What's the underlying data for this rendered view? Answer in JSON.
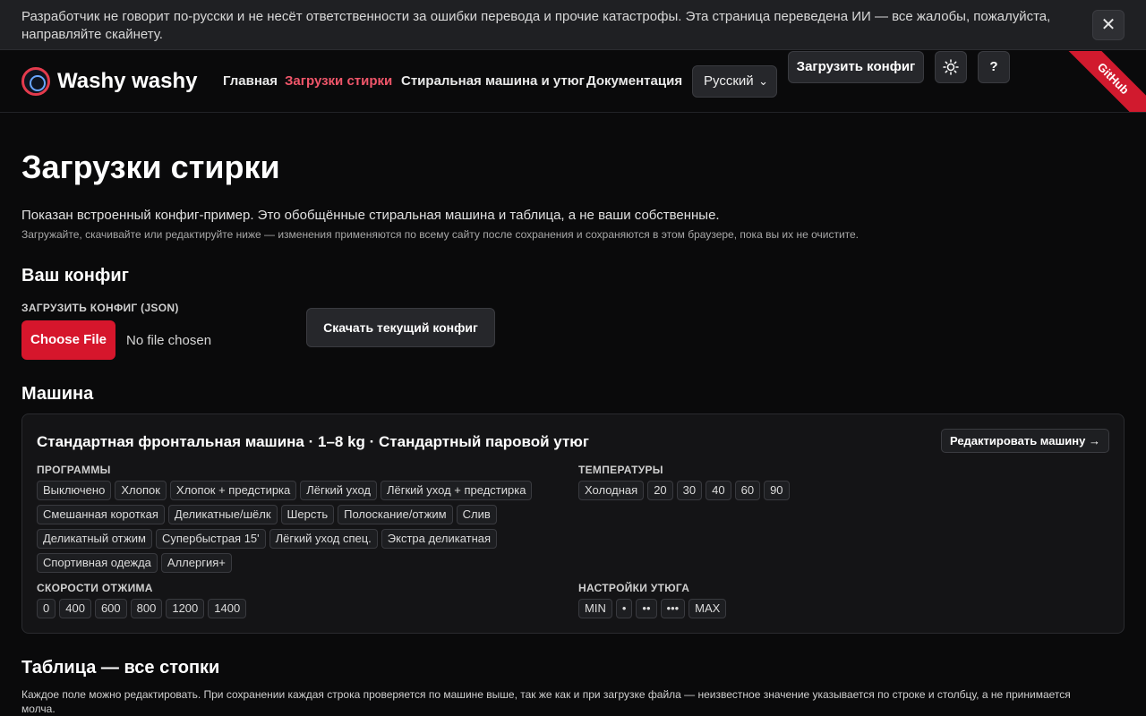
{
  "banner": {
    "text": "Разработчик не говорит по-русски и не несёт ответственности за ошибки перевода и прочие катастрофы. Эта страница переведена ИИ — все жалобы, пожалуйста, направляйте скайнету.",
    "close": "✕"
  },
  "nav": {
    "brand": "Washy washy",
    "links": [
      "Главная",
      "Загрузки стирки",
      "Стиральная машина и утюг",
      "Документация"
    ],
    "language": "Русский",
    "upload_config": "Загрузить конфиг",
    "theme_icon": "sun-icon",
    "help": "?",
    "ribbon": "GitHub"
  },
  "page": {
    "title": "Загрузки стирки",
    "lead": "Показан встроенный конфиг-пример. Это обобщённые стиральная машина и таблица, а не ваши собственные.",
    "sub": "Загружайте, скачивайте или редактируйте ниже — изменения применяются по всему сайту после сохранения и сохраняются в этом браузере, пока вы их не очистите."
  },
  "config": {
    "heading": "Ваш конфиг",
    "upload_label": "ЗАГРУЗИТЬ КОНФИГ (JSON)",
    "choose_file": "Choose File",
    "file_status": "No file chosen",
    "download": "Скачать текущий конфиг"
  },
  "machine": {
    "heading": "Машина",
    "title": "Стандартная фронтальная машина · 1–8 kg · Стандартный паровой утюг",
    "edit": "Редактировать машину →",
    "programs_label": "ПРОГРАММЫ",
    "programs": [
      "Выключено",
      "Хлопок",
      "Хлопок + предстирка",
      "Лёгкий уход",
      "Лёгкий уход + предстирка",
      "Смешанная короткая",
      "Деликатные/шёлк",
      "Шерсть",
      "Полоскание/отжим",
      "Слив",
      "Деликатный отжим",
      "Супербыстрая 15'",
      "Лёгкий уход спец.",
      "Экстра деликатная",
      "Спортивная одежда",
      "Аллергия+"
    ],
    "temps_label": "ТЕМПЕРАТУРЫ",
    "temps": [
      "Холодная",
      "20",
      "30",
      "40",
      "60",
      "90"
    ],
    "spins_label": "СКОРОСТИ ОТЖИМА",
    "spins": [
      "0",
      "400",
      "600",
      "800",
      "1200",
      "1400"
    ],
    "iron_label": "НАСТРОЙКИ УТЮГА",
    "iron": [
      "MIN",
      "•",
      "••",
      "•••",
      "MAX"
    ]
  },
  "table": {
    "heading": "Таблица — все стопки",
    "desc": "Каждое поле можно редактировать. При сохранении каждая строка проверяется по машине выше, так же как и при загрузке файла — неизвестное значение указывается по строке и столбцу, а не принимается молча."
  },
  "colors": {
    "accent": "#d6162c",
    "active_link": "#f0566a",
    "background": "#0a0a0b"
  }
}
